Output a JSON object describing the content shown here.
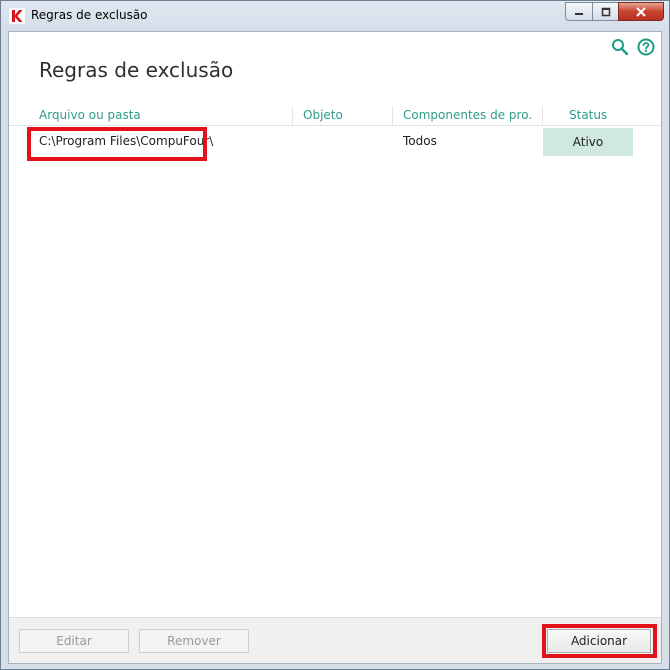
{
  "window": {
    "title": "Regras de exclusão"
  },
  "page": {
    "title": "Regras de exclusão"
  },
  "icons": {
    "app": "kaspersky-k-icon",
    "search": "search-icon",
    "help": "help-icon",
    "minimize": "minimize-icon",
    "maximize": "maximize-icon",
    "close": "close-icon"
  },
  "table": {
    "columns": [
      "Arquivo ou pasta",
      "Objeto",
      "Componentes de pro...",
      "Status"
    ],
    "rows": [
      {
        "path": "C:\\Program Files\\CompuFour\\",
        "object": "",
        "components": "Todos",
        "status": "Ativo"
      }
    ]
  },
  "buttons": {
    "edit": "Editar",
    "remove": "Remover",
    "add": "Adicionar"
  },
  "colors": {
    "accent": "#2f9c8a",
    "status_bg": "#cfe8e1",
    "highlight": "#e3111b"
  }
}
